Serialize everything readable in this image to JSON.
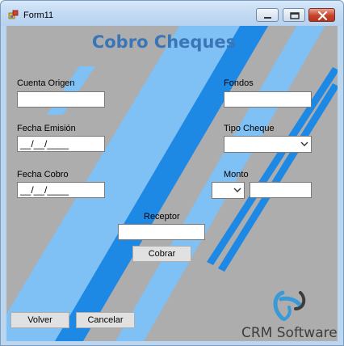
{
  "window": {
    "title": "Form11",
    "controls": [
      "minimize",
      "maximize",
      "close"
    ]
  },
  "form": {
    "heading": "Cobro Cheques",
    "cuenta_origen": {
      "label": "Cuenta Origen",
      "value": ""
    },
    "fondos": {
      "label": "Fondos",
      "value": ""
    },
    "fecha_emision": {
      "label": "Fecha Emisión",
      "value": "__/__/____"
    },
    "tipo_cheque": {
      "label": "Tipo Cheque",
      "value": ""
    },
    "fecha_cobro": {
      "label": "Fecha Cobro",
      "value": "__/__/____"
    },
    "monto": {
      "label": "Monto",
      "currency_value": "",
      "value": ""
    },
    "receptor": {
      "label": "Receptor",
      "value": ""
    }
  },
  "buttons": {
    "cobrar": "Cobrar",
    "volver": "Volver",
    "cancelar": "Cancelar"
  },
  "branding": {
    "company": "CRM Software",
    "logo_icon": "crm-logo-icon"
  },
  "colors": {
    "heading": "#3a76b7",
    "stripe_dark": "#1e88e5",
    "stripe_light": "#7fc0f5",
    "background": "#adadad"
  }
}
